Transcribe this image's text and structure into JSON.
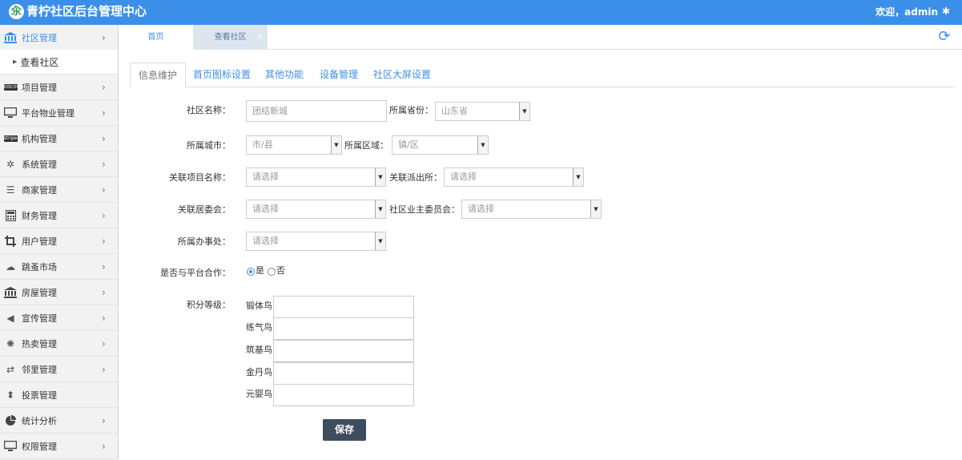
{
  "header": {
    "title": "青柠社区后台管理中心",
    "logo_glyph": "汆",
    "welcome": "欢迎，admin",
    "accent": "#3c8fe8"
  },
  "sidebar": {
    "items": [
      {
        "label": "社区管理",
        "icon": "bank-icon"
      },
      {
        "label": "项目管理",
        "icon": "card-icon"
      },
      {
        "label": "平台物业管理",
        "icon": "monitor-icon"
      },
      {
        "label": "机构管理",
        "icon": "stripe-icon"
      },
      {
        "label": "系统管理",
        "icon": "yelp-icon"
      },
      {
        "label": "商家管理",
        "icon": "menu-icon"
      },
      {
        "label": "财务管理",
        "icon": "calculator-icon"
      },
      {
        "label": "用户管理",
        "icon": "crop-icon"
      },
      {
        "label": "跳蚤市场",
        "icon": "cloud-icon"
      },
      {
        "label": "房屋管理",
        "icon": "bank-icon"
      },
      {
        "label": "宣传管理",
        "icon": "volume-icon"
      },
      {
        "label": "热卖管理",
        "icon": "sun-icon"
      },
      {
        "label": "邻里管理",
        "icon": "retweet-icon"
      },
      {
        "label": "投票管理",
        "icon": "sort-icon"
      },
      {
        "label": "统计分析",
        "icon": "pie-chart-icon"
      },
      {
        "label": "权限管理",
        "icon": "monitor-icon"
      }
    ],
    "sub_item": "查看社区",
    "badge_discover": "DISCOVER",
    "badge_stripe": "stripe"
  },
  "page_tabs": [
    {
      "label": "首页"
    },
    {
      "label": "查看社区"
    }
  ],
  "sub_tabs": [
    {
      "label": "信息维护"
    },
    {
      "label": "首页图标设置"
    },
    {
      "label": "其他功能"
    },
    {
      "label": "设备管理"
    },
    {
      "label": "社区大屏设置"
    }
  ],
  "form": {
    "community_name_label": "社区名称：",
    "community_name_placeholder": "团结新城",
    "province_label": "所属省份：",
    "province_value": "山东省",
    "city_label": "所属城市：",
    "city_value": "市/县",
    "district_label": "所属区域：",
    "district_value": "镇/区",
    "project_label": "关联项目名称：",
    "project_value": "请选择",
    "police_label": "关联派出所：",
    "police_value": "请选择",
    "committee_label": "关联居委会：",
    "committee_value": "请选择",
    "owners_label": "社区业主委员会：",
    "owners_value": "请选择",
    "office_label": "所属办事处：",
    "office_value": "请选择",
    "platform_coop_label": "是否与平台合作：",
    "yes_label": "是",
    "no_label": "否",
    "platform_coop_selected": "是",
    "points_label": "积分等级：",
    "levels": [
      "锻体鸟",
      "练气鸟",
      "筑基鸟",
      "金丹鸟",
      "元婴鸟"
    ],
    "save_label": "保存"
  }
}
